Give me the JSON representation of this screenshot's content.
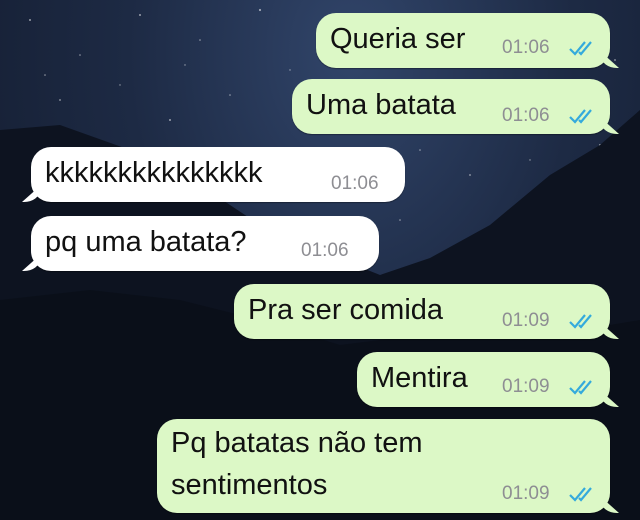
{
  "conversation": {
    "messages": [
      {
        "direction": "outgoing",
        "text": "Queria ser",
        "time": "01:06",
        "status": "read"
      },
      {
        "direction": "outgoing",
        "text": "Uma batata",
        "time": "01:06",
        "status": "read"
      },
      {
        "direction": "incoming",
        "text": "kkkkkkkkkkkkkkk",
        "time": "01:06"
      },
      {
        "direction": "incoming",
        "text": "pq uma batata?",
        "time": "01:06"
      },
      {
        "direction": "outgoing",
        "text": "Pra ser comida",
        "time": "01:09",
        "status": "read"
      },
      {
        "direction": "outgoing",
        "text": "Mentira",
        "time": "01:09",
        "status": "read"
      },
      {
        "direction": "outgoing",
        "text_lines": [
          "Pq batatas não tem",
          "sentimentos"
        ],
        "time": "01:09",
        "status": "read"
      }
    ]
  },
  "colors": {
    "outgoing_bubble": "#dcf8c6",
    "incoming_bubble": "#ffffff",
    "timestamp": "#8e8e93",
    "read_ticks": "#34aadc"
  },
  "icons": {
    "read_status": "double-check-icon"
  }
}
